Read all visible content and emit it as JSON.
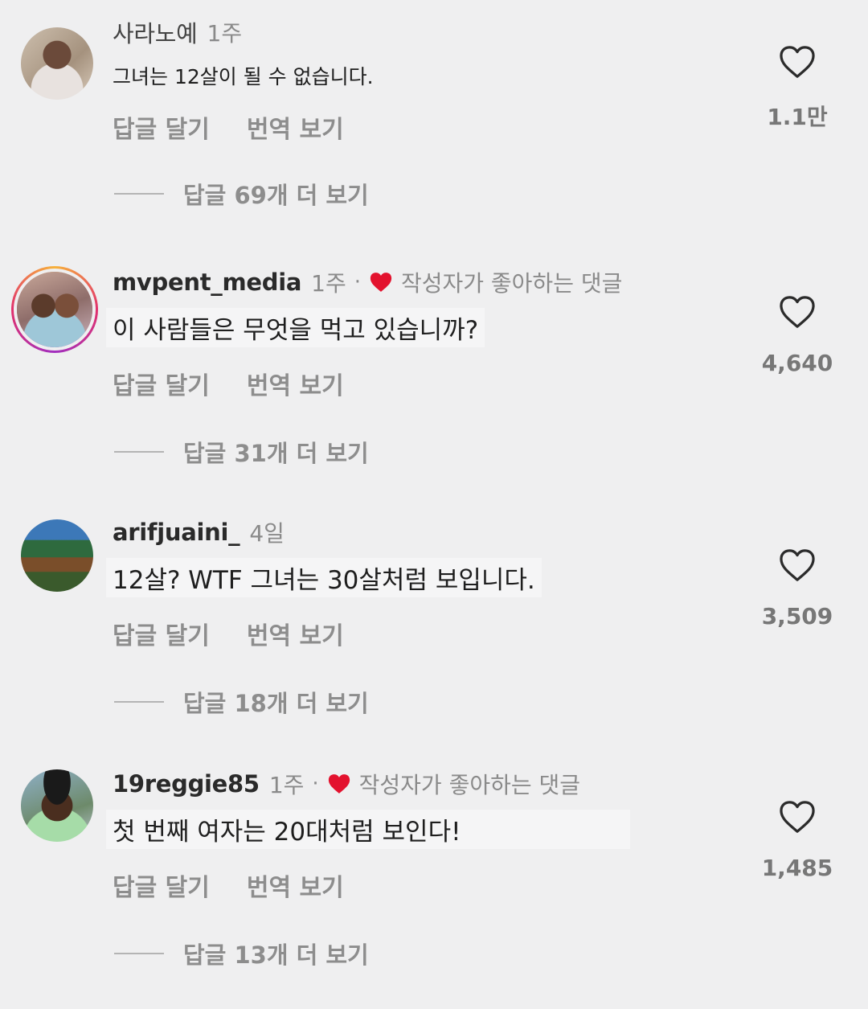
{
  "colors": {
    "background": "#efeff0",
    "muted_text": "#8d8d8d",
    "liked_heart": "#e3122e"
  },
  "comments": [
    {
      "username": "사라노예",
      "time": "1주",
      "text": "그녀는 12살이 될 수 없습니다.",
      "reply_label": "답글 달기",
      "translate_label": "번역 보기",
      "view_replies": "답글 69개 더 보기",
      "likes": "1.1만",
      "creator_liked": false
    },
    {
      "username": "mvpent_media",
      "time": "1주",
      "separator": "·",
      "liked_by_creator_label": "작성자가 좋아하는 댓글",
      "text": "이 사람들은 무엇을 먹고 있습니까?",
      "reply_label": "답글 달기",
      "translate_label": "번역 보기",
      "view_replies": "답글 31개 더 보기",
      "likes": "4,640",
      "creator_liked": true
    },
    {
      "username": "arifjuaini_",
      "time": "4일",
      "text": "12살? WTF 그녀는 30살처럼 보입니다.",
      "reply_label": "답글 달기",
      "translate_label": "번역 보기",
      "view_replies": "답글 18개 더 보기",
      "likes": "3,509",
      "creator_liked": false
    },
    {
      "username": "19reggie85",
      "time": "1주",
      "separator": "·",
      "liked_by_creator_label": "작성자가 좋아하는 댓글",
      "text": "첫 번째 여자는 20대처럼 보인다!",
      "reply_label": "답글 달기",
      "translate_label": "번역 보기",
      "view_replies": "답글 13개 더 보기",
      "likes": "1,485",
      "creator_liked": true
    }
  ]
}
